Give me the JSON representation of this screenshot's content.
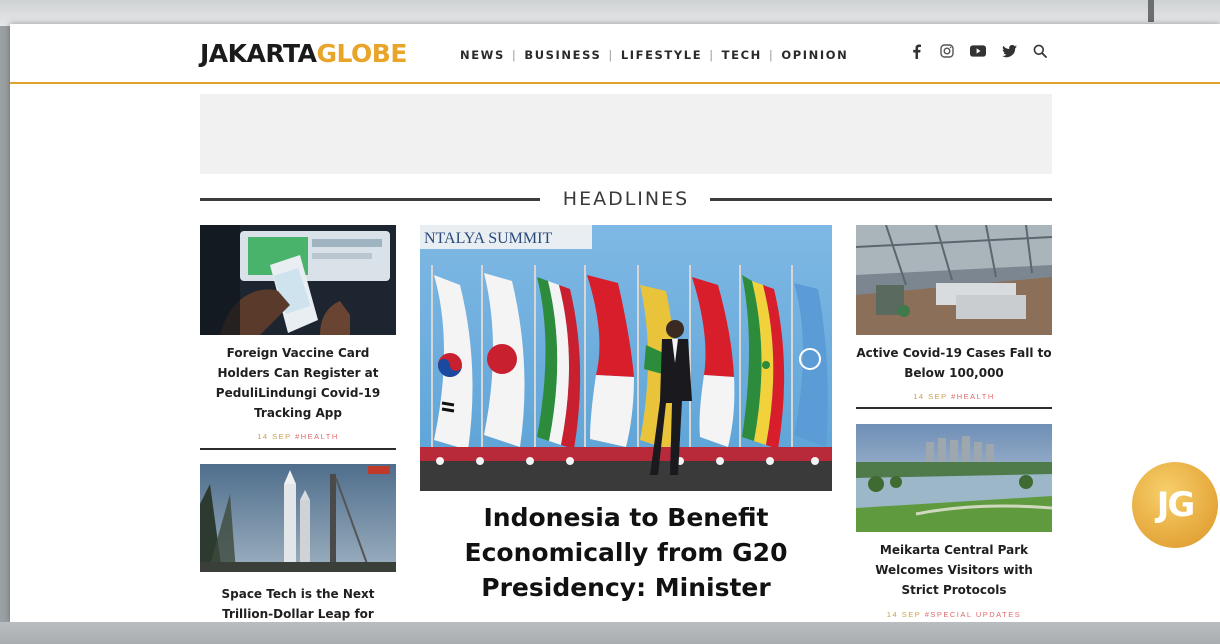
{
  "header": {
    "logo_part1": "JAKARTA",
    "logo_part2": "GLOBE",
    "nav": [
      "NEWS",
      "BUSINESS",
      "LIFESTYLE",
      "TECH",
      "OPINION"
    ],
    "social_icons": [
      "facebook-icon",
      "instagram-icon",
      "youtube-icon",
      "twitter-icon",
      "search-icon"
    ]
  },
  "section": {
    "title": "HEADLINES"
  },
  "left_articles": [
    {
      "title": "Foreign Vaccine Card Holders Can Register at PeduliLindungi Covid-19 Tracking App",
      "date": "14 SEP",
      "category": "#HEALTH"
    },
    {
      "title": "Space Tech is the Next Trillion-Dollar Leap for",
      "date": "",
      "category": ""
    }
  ],
  "main_article": {
    "image_caption": "NTALYA SUMMIT",
    "title": "Indonesia to Benefit Economically from G20 Presidency: Minister"
  },
  "right_articles": [
    {
      "title": "Active Covid-19 Cases Fall to Below 100,000",
      "date": "14 SEP",
      "category": "#HEALTH"
    },
    {
      "title": "Meikarta Central Park Welcomes Visitors with Strict Protocols",
      "date": "14 SEP",
      "category": "#SPECIAL UPDATES"
    }
  ],
  "badge": {
    "text": "JG"
  },
  "colors": {
    "brand_gold": "#e8a52a",
    "accent_red": "#e06a6a",
    "text_dark": "#1f1f1f"
  }
}
